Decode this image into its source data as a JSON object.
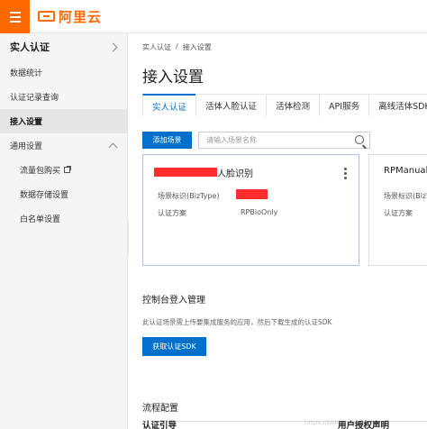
{
  "brand": {
    "name": "阿里云",
    "accent": "#ff6a00"
  },
  "sidebar": {
    "section_title": "实人认证",
    "items": [
      {
        "label": "数据统计"
      },
      {
        "label": "认证记录查询"
      },
      {
        "label": "接入设置",
        "active": true
      }
    ],
    "group": {
      "label": "通用设置",
      "items": [
        {
          "label": "流量包购买",
          "icon": "external-link-icon"
        },
        {
          "label": "数据存储设置"
        },
        {
          "label": "白名单设置"
        }
      ]
    }
  },
  "breadcrumb": {
    "root": "实人认证",
    "separator": "/",
    "current": "接入设置"
  },
  "page_title": "接入设置",
  "tabs": [
    {
      "label": "实人认证",
      "active": true
    },
    {
      "label": "活体人脸认证"
    },
    {
      "label": "活体检测"
    },
    {
      "label": "API服务"
    },
    {
      "label": "离线活体SDK"
    }
  ],
  "toolbar": {
    "add_label": "添加场景",
    "search_placeholder": "请输入场景名称"
  },
  "cards": [
    {
      "title_suffix": "人脸识别",
      "biztype_label": "场景标识(BizType)",
      "scheme_label": "认证方案",
      "scheme_value": "RPBioOnly"
    },
    {
      "title": "RPManual",
      "biztype_label": "场景标识(BizType)",
      "scheme_label": "认证方案"
    }
  ],
  "console_login": {
    "title": "控制台登入管理",
    "description": "此认证场景需上传要集成服务的应用，然后下载生成的认证SDK",
    "button_label": "获取认证SDK"
  },
  "process": {
    "title": "流程配置",
    "step1": "认证引导",
    "step2": "用户授权声明",
    "watermark": "https://blog.csdn.net/..."
  },
  "colors": {
    "primary": "#0070cc",
    "redaction": "#ff2d2d"
  }
}
